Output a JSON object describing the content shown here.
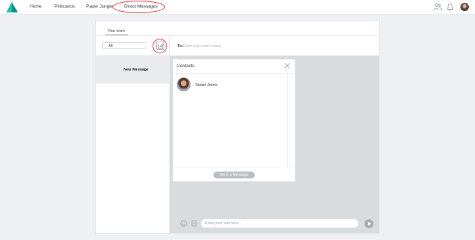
{
  "nav": {
    "items": [
      {
        "label": "Home"
      },
      {
        "label": "Pinboards"
      },
      {
        "label": "Paper Jungle"
      },
      {
        "label": "Direct Messages"
      }
    ],
    "accent_color": "#18c5b4",
    "icons": [
      "people-icon",
      "bell-icon",
      "user-avatar"
    ]
  },
  "sidebar": {
    "tab": "Your team",
    "filter": {
      "selected": "All"
    },
    "new_message_label": "New Message"
  },
  "compose": {
    "to_label": "To:",
    "to_placeholder": "Enter a person's name"
  },
  "contacts": {
    "title": "Contacts",
    "items": [
      {
        "name": "Susan Jones"
      }
    ],
    "send_button": "Send a Message"
  },
  "composer": {
    "placeholder": "Enter your text here...",
    "icons": [
      "emoji-icon",
      "attachment-icon",
      "send-icon"
    ]
  },
  "annotation_color": "#e02b2b"
}
